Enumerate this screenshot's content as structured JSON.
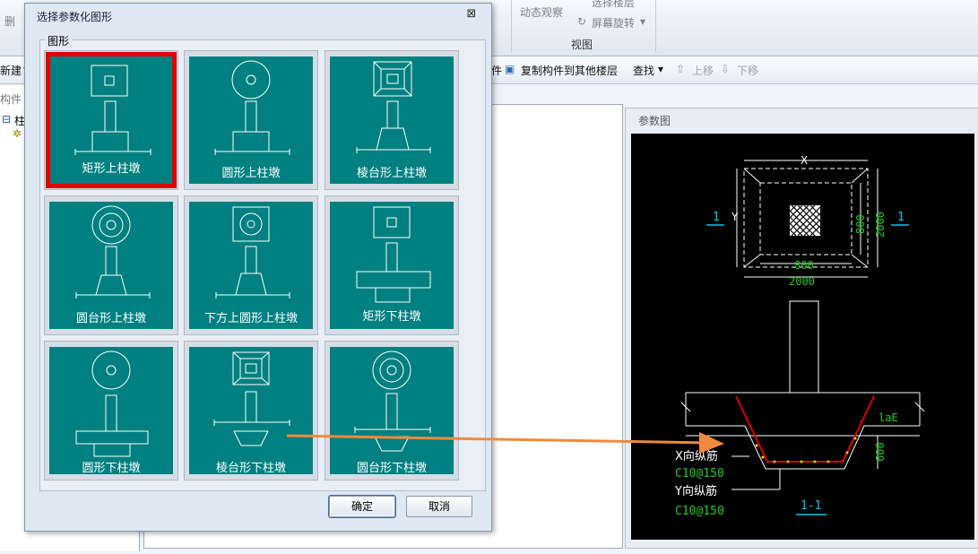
{
  "ribbon": {
    "top_left_label": "删",
    "orbit_label": "动态观察",
    "top_clip": "选择楼层",
    "screen_rotate": "屏幕旋转",
    "view_group": "视图"
  },
  "toolbar": {
    "new_label": "新建",
    "copy_partial": "件",
    "copy_to_floor": "复制构件到其他楼层",
    "find_label": "查找",
    "move_up": "上移",
    "move_down": "下移"
  },
  "tree": {
    "search_hint": "构件",
    "root": "柱"
  },
  "dialog": {
    "title": "选择参数化图形",
    "close_glyph": "⊠",
    "group_label": "图形",
    "shapes": [
      {
        "label": "矩形上柱墩",
        "selected": true
      },
      {
        "label": "圆形上柱墩",
        "selected": false
      },
      {
        "label": "棱台形上柱墩",
        "selected": false
      },
      {
        "label": "圆台形上柱墩",
        "selected": false
      },
      {
        "label": "下方上圆形上柱墩",
        "selected": false
      },
      {
        "label": "矩形下柱墩",
        "selected": false
      },
      {
        "label": "圆形下柱墩",
        "selected": false
      },
      {
        "label": "棱台形下柱墩",
        "selected": false
      },
      {
        "label": "圆台形下柱墩",
        "selected": false
      }
    ],
    "ok_label": "确定",
    "cancel_label": "取消"
  },
  "param_panel": {
    "title": "参数图",
    "dim_x": "X",
    "dim_y": "Y",
    "dim_800_h": "800",
    "dim_2000_h": "2000",
    "dim_800_v": "800",
    "dim_2000_v": "2000",
    "section_mark": "1",
    "lae": "laE",
    "dim_600": "600",
    "x_bar_label": "X向纵筋",
    "x_bar_spec": "C10@150",
    "y_bar_label": "Y向纵筋",
    "y_bar_spec": "C10@150",
    "section_title": "1-1"
  },
  "colors": {
    "tile_bg": "#008080",
    "selection_border": "#e00000",
    "arrow": "#f08a3c",
    "dim_green": "#22cc22",
    "cyan": "#00c8e6",
    "rebar_red": "#e00000"
  }
}
